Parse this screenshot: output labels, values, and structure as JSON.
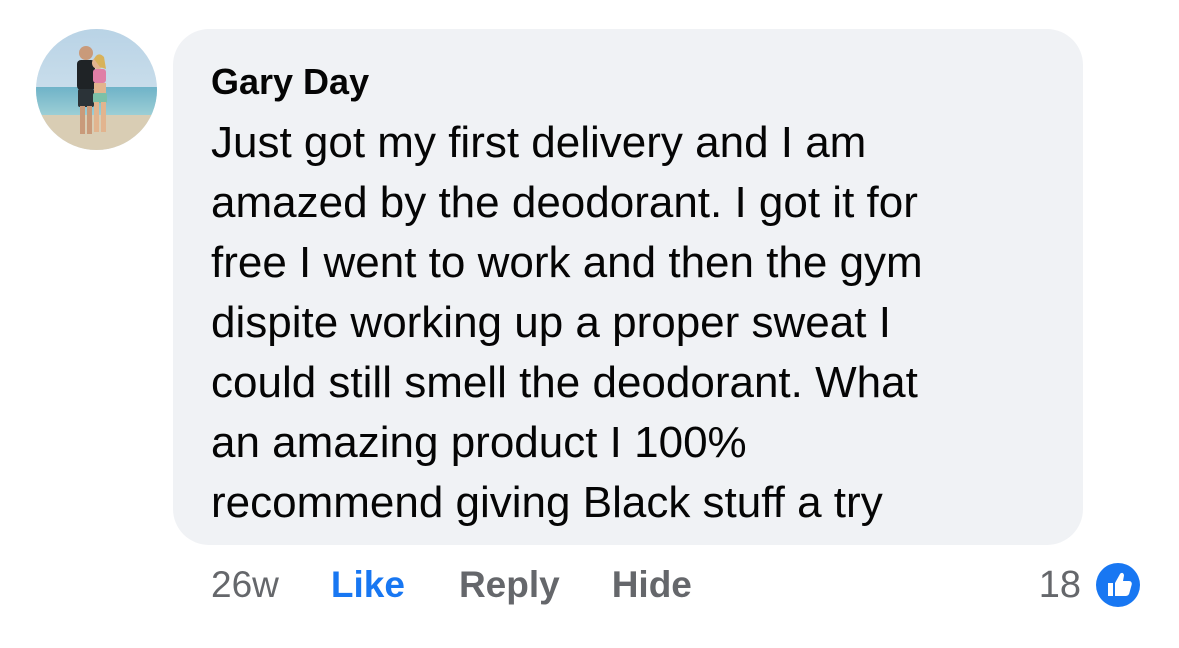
{
  "comment": {
    "author": "Gary Day",
    "lines": [
      "Just got my first delivery and I am",
      "amazed by the deodorant. I got it for",
      "free I went to work and then the gym",
      "dispite working up a proper sweat I",
      "could still smell the deodorant. What",
      "an amazing product I 100%",
      "recommend giving Black stuff a try"
    ],
    "timestamp": "26w",
    "actions": {
      "like_label": "Like",
      "reply_label": "Reply",
      "hide_label": "Hide"
    },
    "reactions": {
      "count": "18",
      "icon": "thumbs-up-icon",
      "color": "#1877f2"
    }
  },
  "colors": {
    "bubble": "#f0f2f5",
    "text": "#050505",
    "secondary": "#65676b",
    "accent": "#1877f2"
  }
}
